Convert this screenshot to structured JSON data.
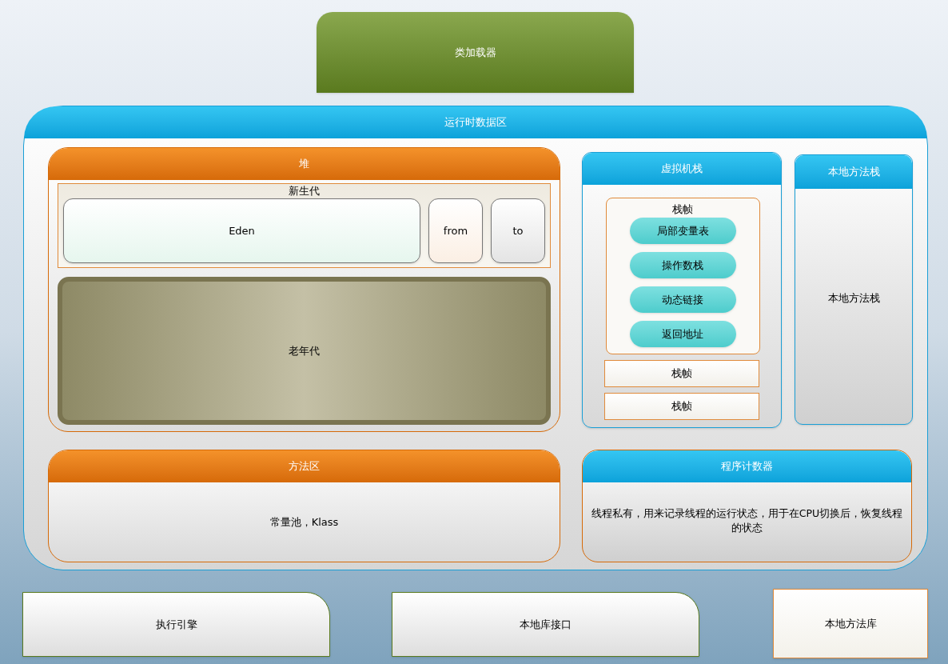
{
  "class_loader": {
    "label": "类加载器"
  },
  "runtime_data_area": {
    "title": "运行时数据区",
    "heap": {
      "title": "堆",
      "young_generation": {
        "title": "新生代",
        "spaces": [
          "Eden",
          "from",
          "to"
        ]
      },
      "old_generation": {
        "label": "老年代"
      }
    },
    "vm_stack": {
      "title": "虚拟机栈",
      "frames": [
        {
          "title": "栈帧",
          "parts": [
            "局部变量表",
            "操作数栈",
            "动态链接",
            "返回地址"
          ]
        },
        {
          "title": "栈帧"
        },
        {
          "title": "栈帧"
        }
      ]
    },
    "native_method_stack": {
      "title": "本地方法栈",
      "body": "本地方法栈"
    },
    "method_area": {
      "title": "方法区",
      "body": "常量池，Klass"
    },
    "program_counter": {
      "title": "程序计数器",
      "body": "线程私有，用来记录线程的运行状态，用于在CPU切换后，恢复线程的状态"
    }
  },
  "bottom": [
    {
      "kind": "rounded",
      "label": "执行引擎"
    },
    {
      "kind": "rounded",
      "label": "本地库接口"
    },
    {
      "kind": "plain",
      "label": "本地方法库"
    }
  ]
}
